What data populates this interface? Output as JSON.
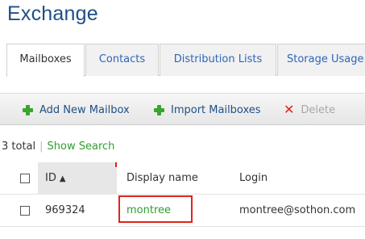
{
  "app": {
    "title": "Exchange"
  },
  "tabs": [
    {
      "label": "Mailboxes",
      "active": true
    },
    {
      "label": "Contacts",
      "active": false
    },
    {
      "label": "Distribution Lists",
      "active": false
    },
    {
      "label": "Storage Usage",
      "active": false
    }
  ],
  "toolbar": {
    "add_label": "Add New Mailbox",
    "import_label": "Import Mailboxes",
    "delete_label": "Delete"
  },
  "summary": {
    "total": "3 total",
    "separator": "|",
    "show_search": "Show Search"
  },
  "table": {
    "columns": {
      "id": "ID",
      "sort_indicator": "▲",
      "display_name": "Display name",
      "login": "Login"
    },
    "rows": [
      {
        "id": "969324",
        "display_name": "montree",
        "login": "montree@sothon.com"
      }
    ]
  },
  "colors": {
    "title": "#1f4f86",
    "tab_link": "#2e66b8",
    "add_icon": "#3aa52d",
    "delete_icon": "#e2231a",
    "link_green": "#2f9e2f",
    "highlight": "#e2231a"
  },
  "icons": {
    "add": "plus-icon",
    "import": "plus-icon",
    "delete": "x-icon",
    "sort": "sort-asc-icon"
  }
}
